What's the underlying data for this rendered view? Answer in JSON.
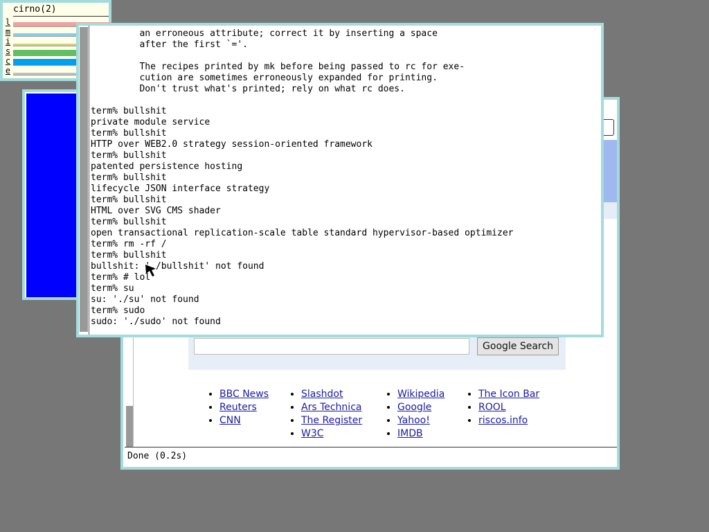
{
  "stats": {
    "title": "cirno(2)",
    "rows": [
      {
        "letter": "l",
        "color": "#f0a0a0",
        "level": 0.55
      },
      {
        "letter": "m",
        "color": "#80d0f0",
        "level": 0.35
      },
      {
        "letter": "i",
        "color": "#d0d080",
        "level": 0.25
      },
      {
        "letter": "s",
        "color": "#60c060",
        "level": 0.7
      },
      {
        "letter": "c",
        "color": "#00a0f0",
        "level": 0.8
      },
      {
        "letter": "e",
        "color": "#c0c0c0",
        "level": 0.3
      }
    ]
  },
  "terminal": {
    "lines": [
      "         an erroneous attribute; correct it by inserting a space",
      "         after the first `='.",
      "",
      "         The recipes printed by mk before being passed to rc for exe-",
      "         cution are sometimes erroneously expanded for printing.",
      "         Don't trust what's printed; rely on what rc does.",
      "",
      "term% bullshit",
      "private module service",
      "term% bullshit",
      "HTTP over WEB2.0 strategy session-oriented framework",
      "term% bullshit",
      "patented persistence hosting",
      "term% bullshit",
      "lifecycle JSON interface strategy",
      "term% bullshit",
      "HTML over SVG CMS shader",
      "term% bullshit",
      "open transactional replication-scale table standard hypervisor-based optimizer",
      "term% rm -rf /",
      "term% bullshit",
      "bullshit: './bullshit' not found",
      "term% # lol",
      "term% su",
      "su: './su' not found",
      "term% sudo",
      "sudo: './sudo' not found"
    ]
  },
  "browser": {
    "search_button": "Google Search",
    "status": "Done (0.2s)",
    "links": {
      "col_a": [
        "BBC News",
        "Reuters",
        "CNN"
      ],
      "col_b": [
        "Slashdot",
        "Ars Technica",
        "The Register",
        "W3C"
      ],
      "col_c": [
        "Wikipedia",
        "Google",
        "Yahoo!",
        "IMDB"
      ],
      "col_d": [
        "The Icon Bar",
        "ROOL",
        "riscos.info"
      ]
    },
    "link_color": "#1a1aa6"
  },
  "colors": {
    "desktop": "#777777",
    "window_border": "#a3dcdc",
    "blue_window": "#0000ff"
  }
}
